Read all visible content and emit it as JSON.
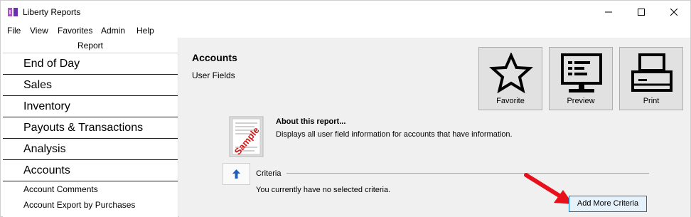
{
  "window": {
    "title": "Liberty Reports"
  },
  "menu": [
    "File",
    "View",
    "Favorites",
    "Admin",
    "Help"
  ],
  "sidebar": {
    "header": "Report",
    "categories": [
      "End of Day",
      "Sales",
      "Inventory",
      "Payouts & Transactions",
      "Analysis",
      "Accounts"
    ],
    "sub_items": [
      "Account Comments",
      "Account Export by Purchases"
    ]
  },
  "report": {
    "title": "Accounts",
    "subtitle": "User Fields",
    "about_title": "About this report...",
    "about_text": "Displays all user field information for accounts that have information.",
    "sample_stamp": "Sample"
  },
  "actions": {
    "favorite": "Favorite",
    "preview": "Preview",
    "print": "Print"
  },
  "criteria": {
    "label": "Criteria",
    "none_text": "You currently have no selected criteria.",
    "add_button": "Add More Criteria"
  },
  "colors": {
    "accent": "#0078d7",
    "arrow": "#e8101a",
    "panel": "#f0f0f0"
  }
}
